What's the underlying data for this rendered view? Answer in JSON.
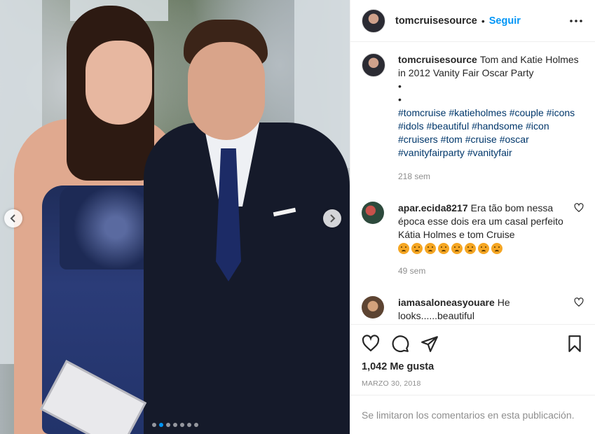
{
  "header": {
    "username": "tomcruisesource",
    "separator": "•",
    "follow_label": "Seguir"
  },
  "caption": {
    "username": "tomcruisesource",
    "text": "Tom and Katie Holmes in 2012 Vanity Fair Oscar Party",
    "bullets": [
      "•",
      "•"
    ],
    "hashtags": "#tomcruise #katieholmes #couple #icons #idols #beautiful #handsome #icon #cruisers #tom #cruise #oscar #vanityfairparty #vanityfair",
    "time": "218 sem"
  },
  "comments": [
    {
      "username": "apar.ecida8217",
      "text": "Era tão bom nessa época esse dois era um casal perfeito Kátia Holmes e tom Cruise",
      "emoji_count": 8,
      "time": "49 sem"
    },
    {
      "username": "iamasaloneasyouare",
      "text": "He looks......beautiful"
    }
  ],
  "likes": "1,042 Me gusta",
  "date": "MARZO 30, 2018",
  "comments_limited": "Se limitaron los comentarios en esta publicación.",
  "carousel": {
    "total": 7,
    "active_index": 1
  },
  "colors": {
    "accent": "#0095f6",
    "hashtag": "#00376b",
    "muted": "#8e8e8e"
  },
  "icons": [
    "more-icon",
    "heart-icon",
    "comment-icon",
    "share-icon",
    "bookmark-icon",
    "chevron-left-icon",
    "chevron-right-icon"
  ]
}
